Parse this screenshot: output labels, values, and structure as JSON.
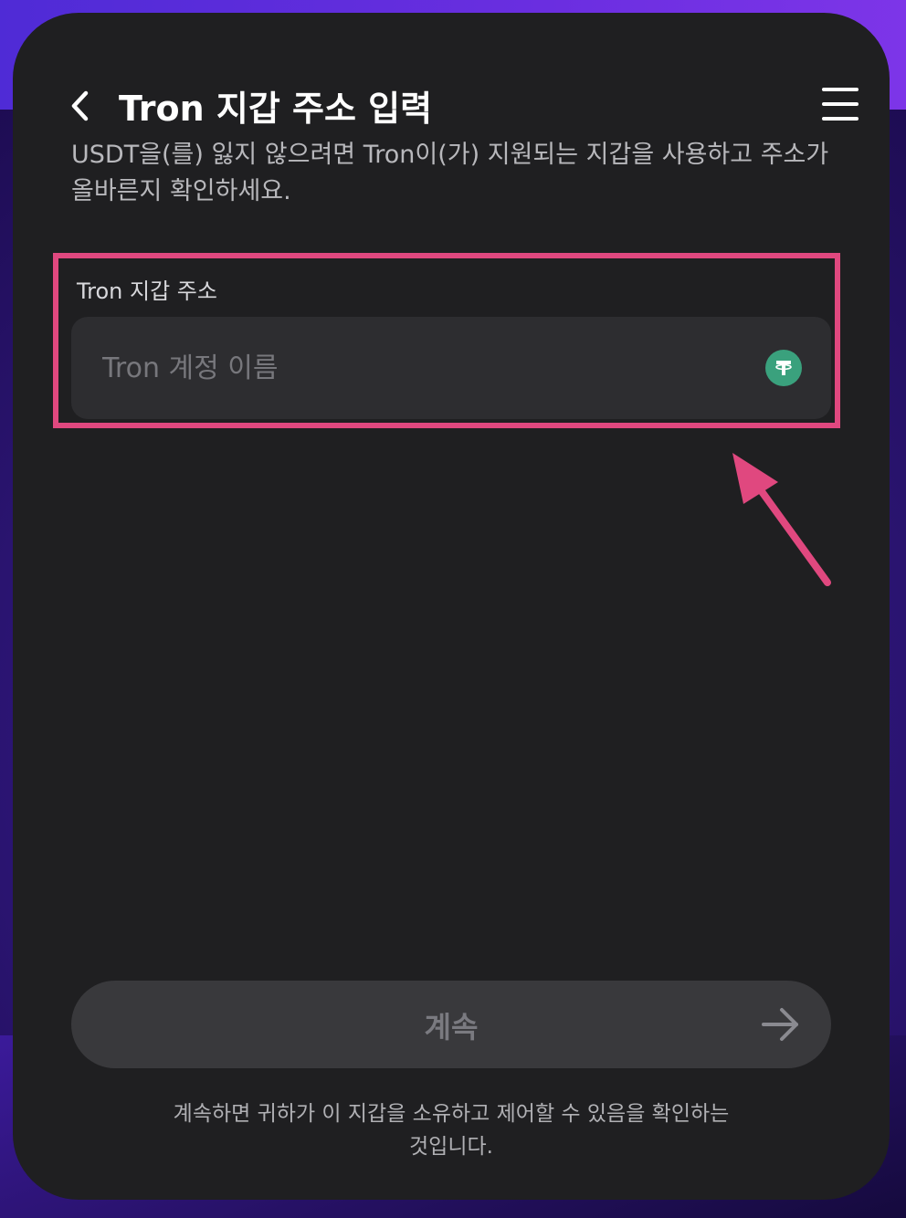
{
  "header": {
    "back_icon": "chevron-left-icon",
    "title": "Tron 지갑 주소 입력",
    "menu_icon": "hamburger-menu-icon"
  },
  "description": "USDT을(를) 잃지 않으려면 Tron이(가) 지원되는 지갑을 사용하고 주소가 올바른지 확인하세요.",
  "address_field": {
    "label": "Tron 지갑 주소",
    "placeholder": "Tron 계정 이름",
    "value": "",
    "icon": "tether-usdt-icon",
    "icon_color": "#3aa17d",
    "highlight_color": "#e0487f"
  },
  "continue_button": {
    "label": "계속",
    "icon": "arrow-right-icon"
  },
  "footer_note": "계속하면 귀하가 이 지갑을 소유하고 제어할 수 있음을 확인하는 것입니다."
}
